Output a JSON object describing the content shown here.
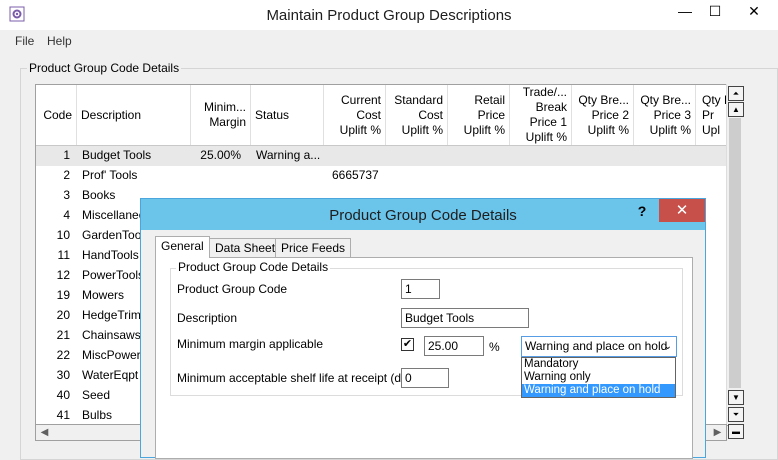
{
  "window": {
    "title": "Maintain Product Group Descriptions",
    "min": "—",
    "max": "☐",
    "close": "✕"
  },
  "menu": {
    "file": "File",
    "help": "Help"
  },
  "group_label": "Product Group Code Details",
  "grid": {
    "headers": [
      "Code",
      "Description",
      "Minim...\nMargin",
      "Status",
      "Current\nCost\nUplift %",
      "Standard\nCost\nUplift %",
      "Retail\nPrice\nUplift %",
      "Trade/...\nBreak\nPrice 1\nUplift %",
      "Qty Bre...\nPrice 2\nUplift %",
      "Qty Bre...\nPrice 3\nUplift %",
      "Qty B\nPr\nUpl"
    ],
    "rows": [
      {
        "code": "1",
        "desc": "Budget Tools",
        "margin": "25.00%",
        "status": "Warning a...",
        "current": ""
      },
      {
        "code": "2",
        "desc": "Prof' Tools",
        "margin": "",
        "status": "",
        "current": "6665737"
      },
      {
        "code": "3",
        "desc": "Books",
        "margin": "",
        "status": "",
        "current": ""
      },
      {
        "code": "4",
        "desc": "Miscellaneou",
        "margin": "",
        "status": "",
        "current": ""
      },
      {
        "code": "10",
        "desc": "GardenTools",
        "margin": "",
        "status": "",
        "current": ""
      },
      {
        "code": "11",
        "desc": "HandTools",
        "margin": "",
        "status": "",
        "current": ""
      },
      {
        "code": "12",
        "desc": "PowerTools",
        "margin": "",
        "status": "",
        "current": ""
      },
      {
        "code": "19",
        "desc": "Mowers",
        "margin": "",
        "status": "",
        "current": ""
      },
      {
        "code": "20",
        "desc": "HedgeTrimm",
        "margin": "",
        "status": "",
        "current": ""
      },
      {
        "code": "21",
        "desc": "Chainsaws",
        "margin": "",
        "status": "",
        "current": ""
      },
      {
        "code": "22",
        "desc": "MiscPower",
        "margin": "",
        "status": "",
        "current": ""
      },
      {
        "code": "30",
        "desc": "WaterEqpt",
        "margin": "",
        "status": "",
        "current": ""
      },
      {
        "code": "40",
        "desc": "Seed",
        "margin": "",
        "status": "",
        "current": ""
      },
      {
        "code": "41",
        "desc": "Bulbs",
        "margin": "",
        "status": "",
        "current": ""
      }
    ]
  },
  "dialog": {
    "title": "Product Group Code Details",
    "help": "?",
    "close": "✕",
    "tabs": [
      "General",
      "Data Sheet",
      "Price Feeds"
    ],
    "fieldset_label": "Product Group Code Details",
    "code_label": "Product Group Code",
    "code_value": "1",
    "desc_label": "Description",
    "desc_value": "Budget Tools",
    "margin_label": "Minimum margin applicable",
    "margin_checked": "✔",
    "margin_value": "25.00",
    "pct": "%",
    "status_selected": "Warning and place on hold",
    "status_options": [
      "Mandatory",
      "Warning only",
      "Warning and place on hold"
    ],
    "shelf_label": "Minimum acceptable shelf life at receipt (days)",
    "shelf_value": "0"
  }
}
